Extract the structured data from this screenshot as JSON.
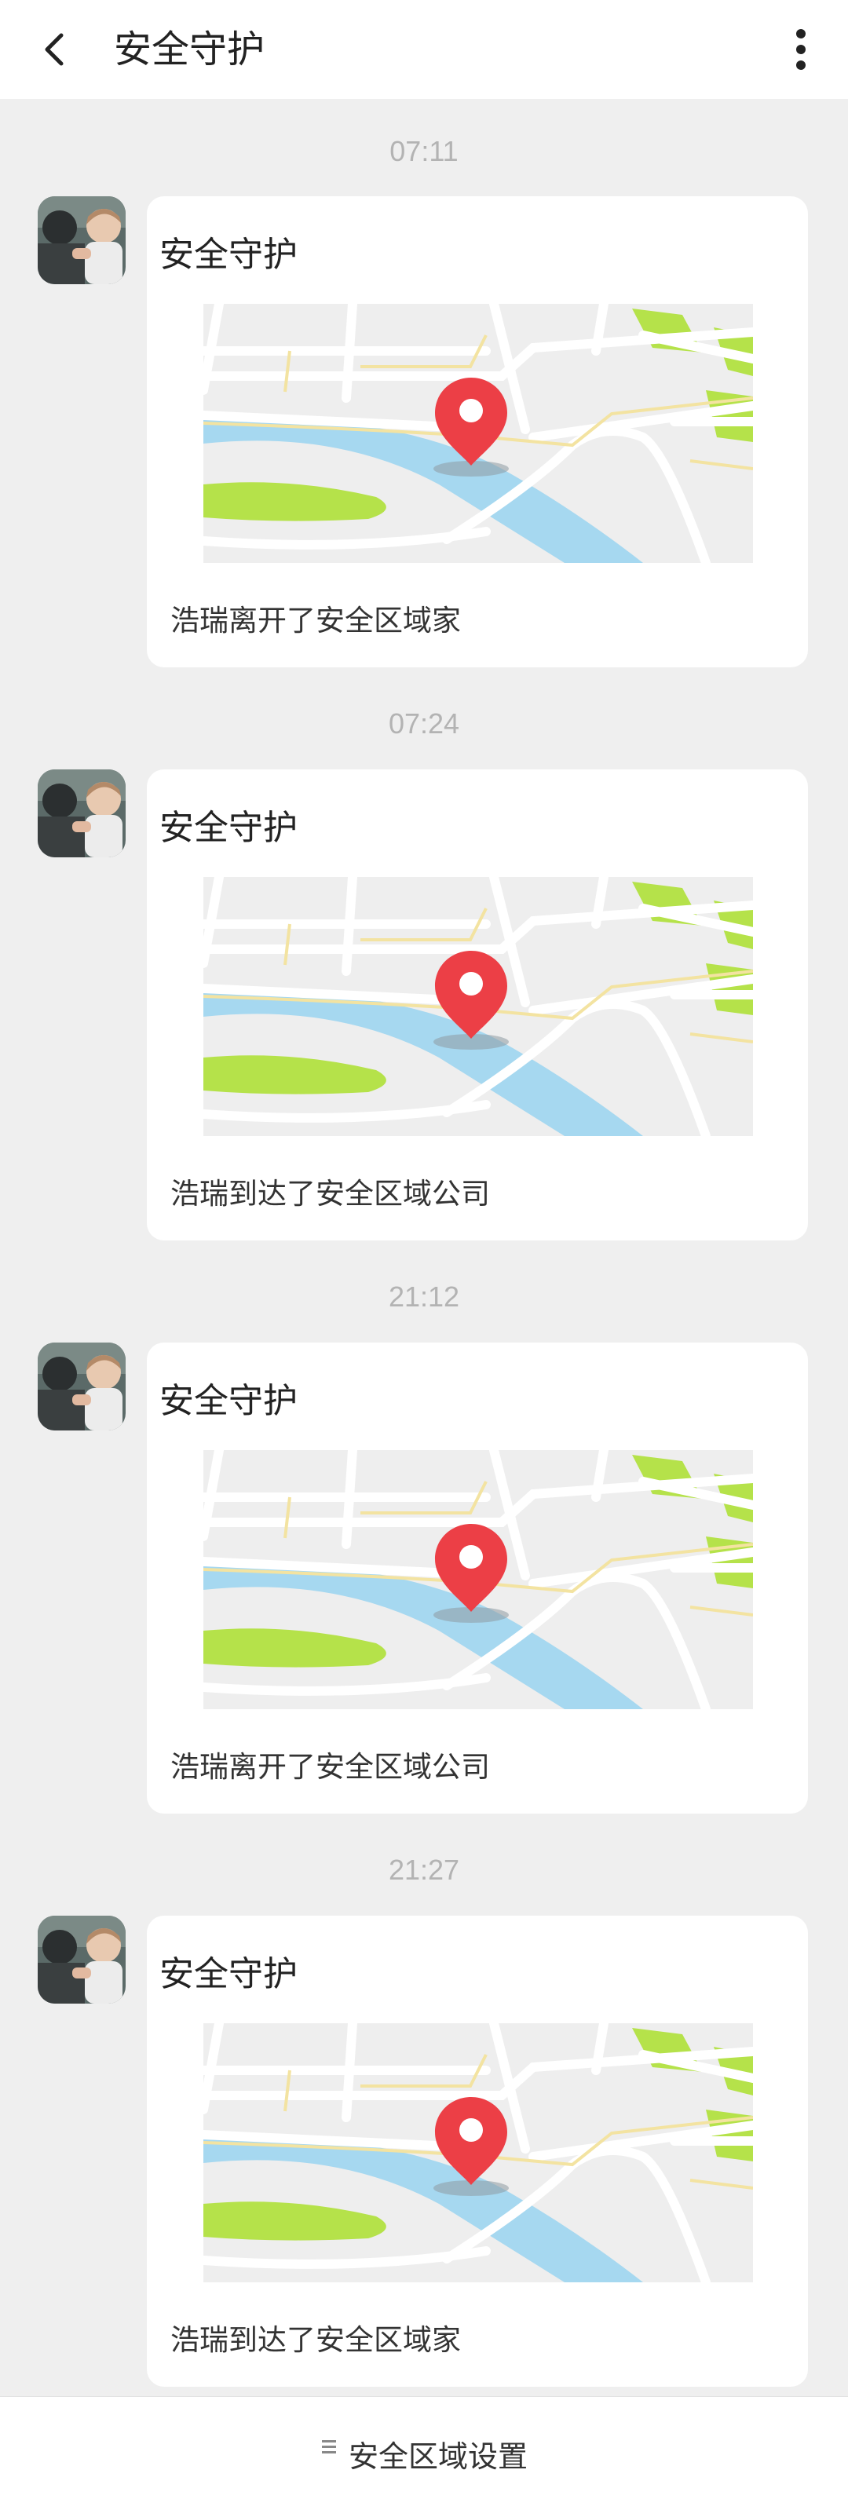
{
  "header": {
    "title": "安全守护"
  },
  "messages": [
    {
      "time": "07:11",
      "title": "安全守护",
      "text": "浩瑞离开了安全区域家"
    },
    {
      "time": "07:24",
      "title": "安全守护",
      "text": "浩瑞到达了安全区域公司"
    },
    {
      "time": "21:12",
      "title": "安全守护",
      "text": "浩瑞离开了安全区域公司"
    },
    {
      "time": "21:27",
      "title": "安全守护",
      "text": "浩瑞到达了安全区域家"
    }
  ],
  "footer": {
    "settings_label": "安全区域设置"
  },
  "colors": {
    "accent_pin": "#ec3f46",
    "map_water": "#a6d8f0",
    "map_park": "#b5e24a",
    "map_land": "#eeeeee"
  },
  "icons": {
    "back": "chevron-left-icon",
    "more": "more-vertical-icon",
    "location": "map-pin-icon",
    "settings": "menu-lines-icon"
  }
}
